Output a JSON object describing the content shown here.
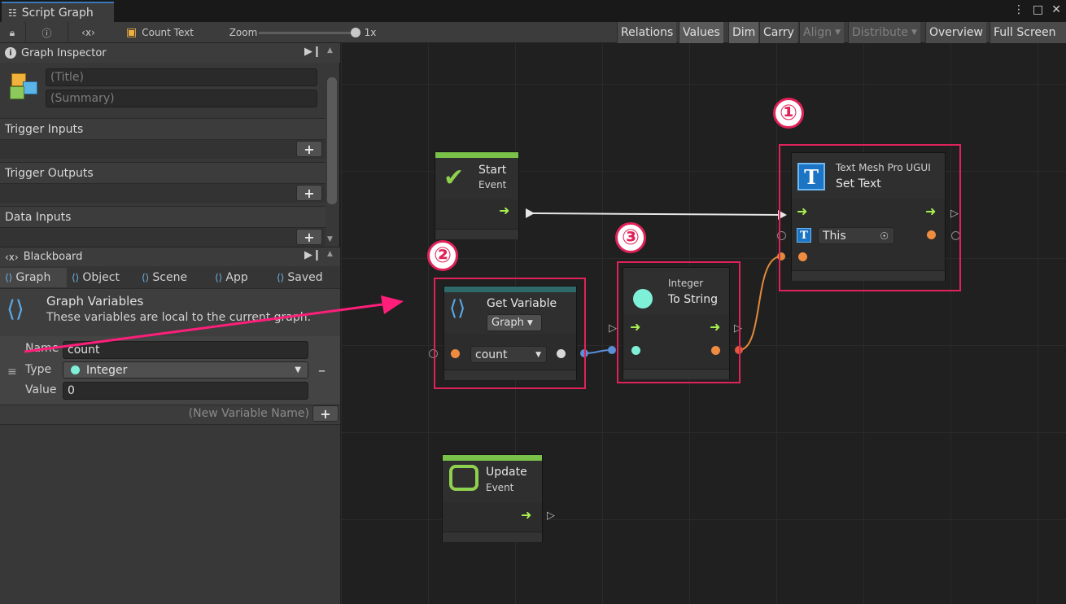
{
  "window": {
    "tab_title": "Script Graph",
    "menu_icon": "kebab-icon",
    "maximize_icon": "maximize-icon",
    "close_icon": "close-icon"
  },
  "toolbar": {
    "lock_icon": "lock-icon",
    "info_icon": "info-icon",
    "variables_icon": "variables-icon",
    "object_name": "Count Text",
    "zoom_label": "Zoom",
    "zoom_value_label": "1x",
    "zoom_level": 1,
    "buttons": [
      "Relations",
      "Values",
      "Dim",
      "Carry",
      "Align",
      "Distribute",
      "Overview",
      "Full Screen"
    ]
  },
  "inspector": {
    "title": "Graph Inspector",
    "title_placeholder": "(Title)",
    "summary_placeholder": "(Summary)",
    "sections": [
      "Trigger Inputs",
      "Trigger Outputs",
      "Data Inputs"
    ]
  },
  "blackboard": {
    "title": "Blackboard",
    "tabs": [
      "Graph",
      "Object",
      "Scene",
      "App",
      "Saved"
    ],
    "active_tab": "Graph",
    "heading": "Graph Variables",
    "description": "These variables are local to the current graph.",
    "variable": {
      "name_label": "Name",
      "name_value": "count",
      "type_label": "Type",
      "type_value": "Integer",
      "value_label": "Value",
      "value_value": "0"
    },
    "new_variable_placeholder": "(New Variable Name)"
  },
  "nodes": {
    "start": {
      "title": "Start",
      "subtitle": "Event",
      "header_color": "#7ac14a"
    },
    "update": {
      "title": "Update",
      "subtitle": "Event",
      "header_color": "#7ac14a"
    },
    "get_variable": {
      "title": "Get Variable",
      "kind": "Graph",
      "variable": "count",
      "header_color": "#2e6a6a"
    },
    "to_string": {
      "subtitle": "Integer",
      "title": "To String"
    },
    "set_text": {
      "subtitle": "Text Mesh Pro UGUI",
      "title": "Set Text",
      "target": "This"
    }
  },
  "annotations": {
    "marker_1": "①",
    "marker_2": "②",
    "marker_3": "③",
    "highlight_color": "#e0225a"
  },
  "colors": {
    "control_flow": "#a8f050",
    "integer_port": "#f08c40",
    "string_port": "#f08c40",
    "wire_int": "#5b8fd6",
    "wire_string": "#e08a3c"
  }
}
